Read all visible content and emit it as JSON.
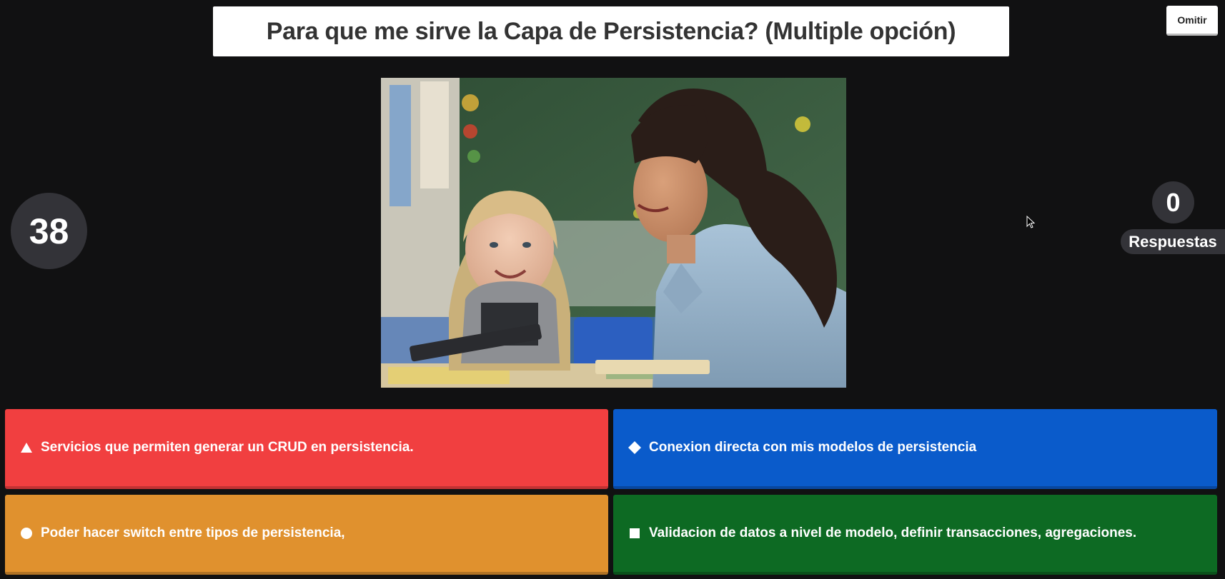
{
  "question": {
    "title": "Para que me sirve la Capa de Persistencia? (Multiple opción)"
  },
  "controls": {
    "skip_label": "Omitir"
  },
  "timer": {
    "seconds": "38"
  },
  "responses": {
    "count": "0",
    "label": "Respuestas"
  },
  "answers": [
    {
      "icon": "triangle-icon",
      "color": "#f13f40",
      "text": "Servicios que permiten generar un CRUD en persistencia."
    },
    {
      "icon": "diamond-icon",
      "color": "#0a5bcb",
      "text": "Conexion directa con mis modelos de persistencia"
    },
    {
      "icon": "circle-icon",
      "color": "#e0912e",
      "text": "Poder hacer switch entre tipos de persistencia,"
    },
    {
      "icon": "square-icon",
      "color": "#0d6a23",
      "text": "Validacion de datos a nivel de modelo, definir transacciones, agregaciones."
    }
  ],
  "media": {
    "image": "classroom-photo"
  }
}
